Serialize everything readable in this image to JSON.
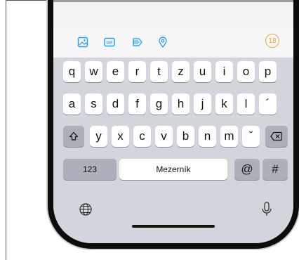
{
  "toolbar": {
    "icons": [
      "image-icon",
      "gif-icon",
      "poll-icon",
      "location-icon"
    ],
    "char_counter": "18",
    "accent": "#1d9bf0",
    "counter_color": "#f0a23a"
  },
  "keyboard": {
    "row1": [
      "q",
      "w",
      "e",
      "r",
      "t",
      "z",
      "u",
      "i",
      "o",
      "p"
    ],
    "row2": [
      "a",
      "s",
      "d",
      "f",
      "g",
      "h",
      "j",
      "k",
      "l",
      "´"
    ],
    "row3": [
      "y",
      "x",
      "c",
      "v",
      "b",
      "n",
      "m",
      "ˇ"
    ],
    "numbers_label": "123",
    "space_label": "Mezerník",
    "at_label": "@",
    "hash_label": "#"
  }
}
